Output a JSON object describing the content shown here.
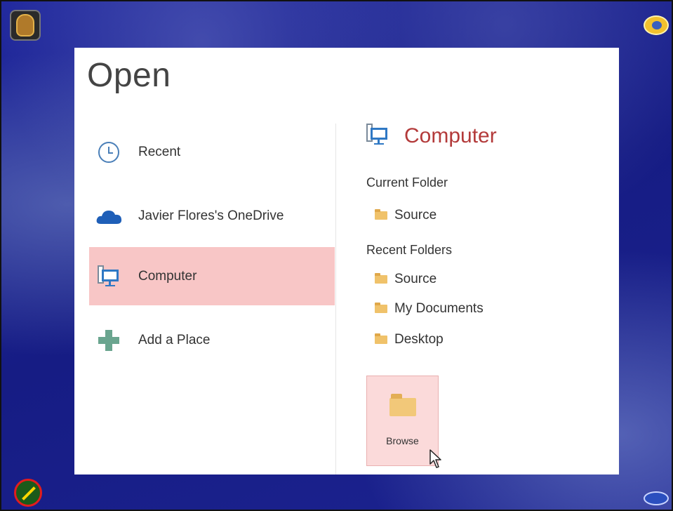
{
  "dialog": {
    "title": "Open"
  },
  "places": [
    {
      "label": "Recent",
      "icon": "clock-icon",
      "selected": false
    },
    {
      "label": "Javier Flores's OneDrive",
      "icon": "onedrive-cloud-icon",
      "selected": false
    },
    {
      "label": "Computer",
      "icon": "computer-icon",
      "selected": true
    },
    {
      "label": "Add a Place",
      "icon": "plus-icon",
      "selected": false
    }
  ],
  "right_panel": {
    "heading": "Computer",
    "current_folder_label": "Current Folder",
    "current_folder": [
      "Source"
    ],
    "recent_folders_label": "Recent Folders",
    "recent_folders": [
      "Source",
      "My Documents",
      "Desktop"
    ],
    "browse_label": "Browse"
  },
  "colors": {
    "selected_bg": "#f8c6c6",
    "heading": "#b33a3a",
    "onedrive": "#1f5fb8",
    "add_place": "#6aa58f",
    "background": "#1a1f8c"
  }
}
